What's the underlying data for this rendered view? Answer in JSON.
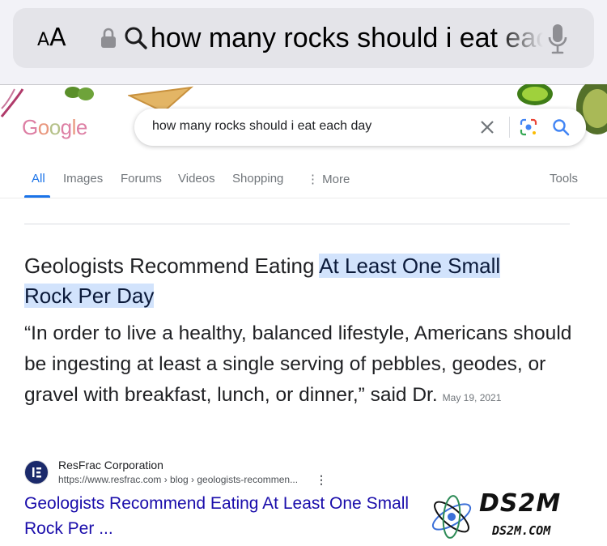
{
  "safari": {
    "text_size_small": "A",
    "text_size_large": "A",
    "address_text": "how many rocks should i eat each day"
  },
  "google": {
    "logo_letters": [
      {
        "ch": "G",
        "color": "#c2185b"
      },
      {
        "ch": "o",
        "color": "#d84315"
      },
      {
        "ch": "o",
        "color": "#7a8f2a"
      },
      {
        "ch": "g",
        "color": "#c2185b"
      },
      {
        "ch": "l",
        "color": "#d84315"
      },
      {
        "ch": "e",
        "color": "#c2185b"
      }
    ],
    "search_query": "how many rocks should i eat each day",
    "icons": {
      "clear": "close-icon",
      "lens": "google-lens-icon",
      "search": "search-icon"
    }
  },
  "tabs": {
    "all": "All",
    "images": "Images",
    "forums": "Forums",
    "videos": "Videos",
    "shopping": "Shopping",
    "more": "More",
    "tools": "Tools"
  },
  "snippet": {
    "title_plain": "Geologists Recommend Eating ",
    "title_highlight_1": "At Least One Small",
    "title_highlight_2": "Rock Per Day",
    "body": "“In order to live a healthy, balanced lifestyle, Americans should be ingesting at least a single serving of pebbles, geodes, or gravel with breakfast, lunch, or dinner,” said Dr.",
    "date": "May 19, 2021"
  },
  "source": {
    "name": "ResFrac Corporation",
    "url": "https://www.resfrac.com › blog › geologists-recommen...",
    "more": "⋮",
    "link_title": "Geologists Recommend Eating At Least One Small Rock Per ..."
  },
  "watermark": {
    "name": "DS2M",
    "url": "DS2M.COM"
  },
  "colors": {
    "link": "#1a0dab",
    "accent": "#1a73e8",
    "highlight": "#d2e3fc"
  }
}
